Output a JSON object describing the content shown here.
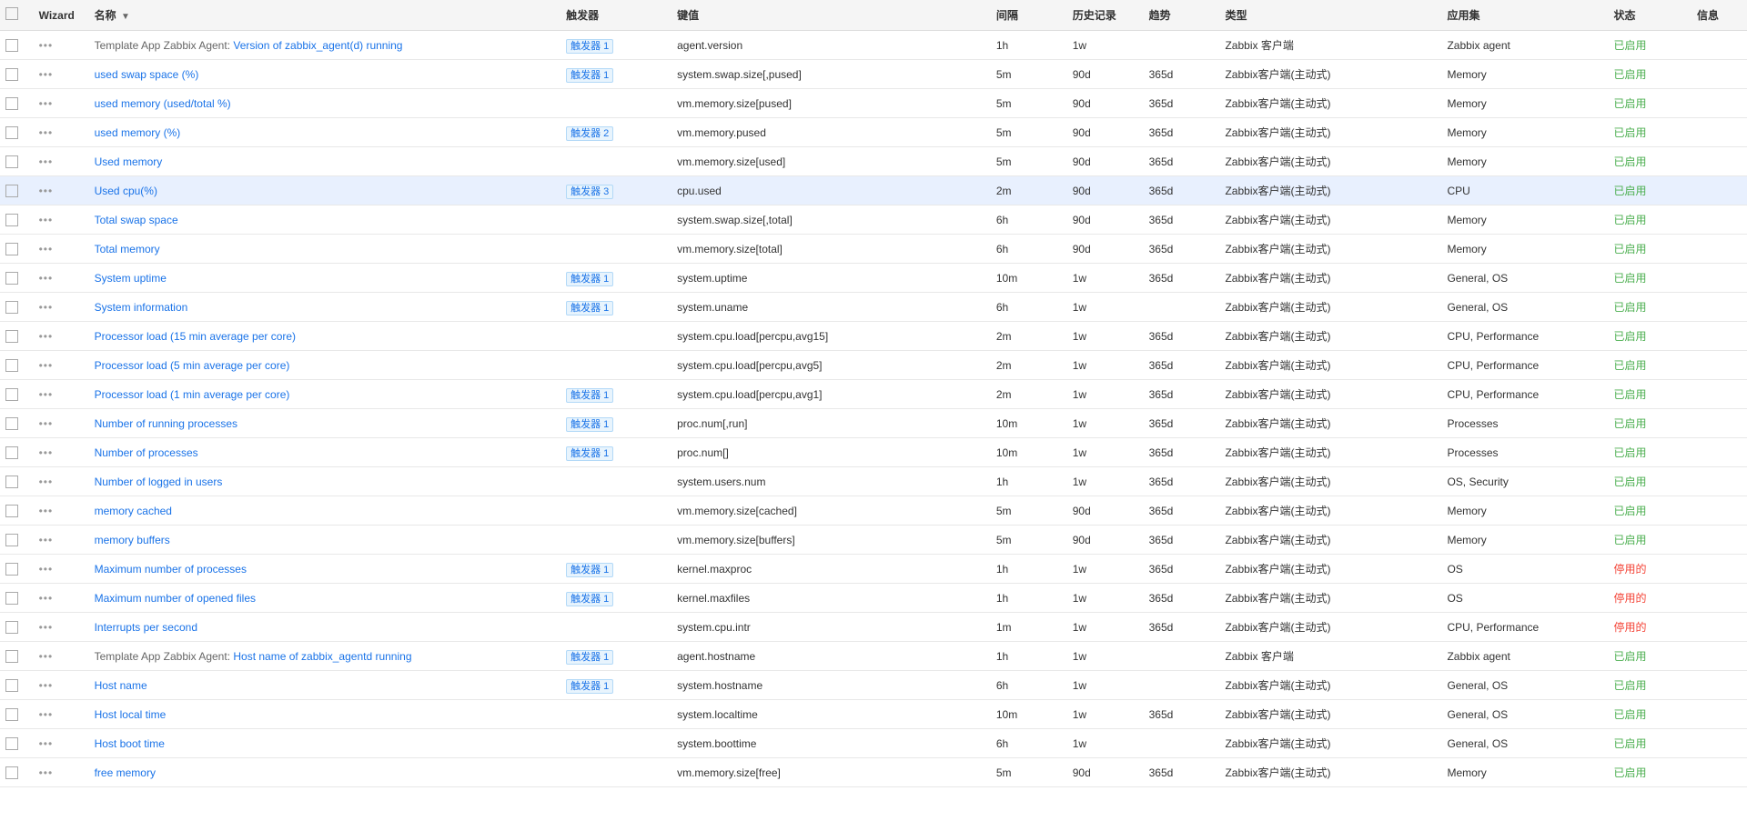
{
  "columns": {
    "checkbox": "",
    "wizard": "Wizard",
    "name": "名称",
    "trigger": "触发器",
    "key": "键值",
    "interval": "间隔",
    "history": "历史记录",
    "trend": "趋势",
    "type": "类型",
    "appgroup": "应用集",
    "status": "状态",
    "info": "信息"
  },
  "rows": [
    {
      "id": 1,
      "name": "Template App Zabbix Agent: Version of zabbix_agent(d) running",
      "namePrefix": "Template App Zabbix Agent: ",
      "nameSuffix": "Version of zabbix_agent(d) running",
      "trigger": "触发器 1",
      "key": "agent.version",
      "interval": "1h",
      "history": "1w",
      "trend": "",
      "type": "Zabbix 客户端",
      "appgroup": "Zabbix agent",
      "status": "已启用",
      "statusClass": "status-enabled",
      "highlighted": false
    },
    {
      "id": 2,
      "name": "used swap space (%)",
      "namePrefix": "",
      "nameSuffix": "used swap space (%)",
      "trigger": "触发器 1",
      "key": "system.swap.size[,pused]",
      "interval": "5m",
      "history": "90d",
      "trend": "365d",
      "type": "Zabbix客户端(主动式)",
      "appgroup": "Memory",
      "status": "已启用",
      "statusClass": "status-enabled",
      "highlighted": false
    },
    {
      "id": 3,
      "name": "used memory (used/total %)",
      "namePrefix": "",
      "nameSuffix": "used memory (used/total %)",
      "trigger": "",
      "key": "vm.memory.size[pused]",
      "interval": "5m",
      "history": "90d",
      "trend": "365d",
      "type": "Zabbix客户端(主动式)",
      "appgroup": "Memory",
      "status": "已启用",
      "statusClass": "status-enabled",
      "highlighted": false
    },
    {
      "id": 4,
      "name": "used memory (%)",
      "namePrefix": "",
      "nameSuffix": "used memory (%)",
      "trigger": "触发器 2",
      "key": "vm.memory.pused",
      "interval": "5m",
      "history": "90d",
      "trend": "365d",
      "type": "Zabbix客户端(主动式)",
      "appgroup": "Memory",
      "status": "已启用",
      "statusClass": "status-enabled",
      "highlighted": false
    },
    {
      "id": 5,
      "name": "Used memory",
      "namePrefix": "",
      "nameSuffix": "Used memory",
      "trigger": "",
      "key": "vm.memory.size[used]",
      "interval": "5m",
      "history": "90d",
      "trend": "365d",
      "type": "Zabbix客户端(主动式)",
      "appgroup": "Memory",
      "status": "已启用",
      "statusClass": "status-enabled",
      "highlighted": false
    },
    {
      "id": 6,
      "name": "Used cpu(%)",
      "namePrefix": "",
      "nameSuffix": "Used cpu(%)",
      "trigger": "触发器 3",
      "key": "cpu.used",
      "interval": "2m",
      "history": "90d",
      "trend": "365d",
      "type": "Zabbix客户端(主动式)",
      "appgroup": "CPU",
      "status": "已启用",
      "statusClass": "status-enabled",
      "highlighted": true
    },
    {
      "id": 7,
      "name": "Total swap space",
      "namePrefix": "",
      "nameSuffix": "Total swap space",
      "trigger": "",
      "key": "system.swap.size[,total]",
      "interval": "6h",
      "history": "90d",
      "trend": "365d",
      "type": "Zabbix客户端(主动式)",
      "appgroup": "Memory",
      "status": "已启用",
      "statusClass": "status-enabled",
      "highlighted": false
    },
    {
      "id": 8,
      "name": "Total memory",
      "namePrefix": "",
      "nameSuffix": "Total memory",
      "trigger": "",
      "key": "vm.memory.size[total]",
      "interval": "6h",
      "history": "90d",
      "trend": "365d",
      "type": "Zabbix客户端(主动式)",
      "appgroup": "Memory",
      "status": "已启用",
      "statusClass": "status-enabled",
      "highlighted": false
    },
    {
      "id": 9,
      "name": "System uptime",
      "namePrefix": "",
      "nameSuffix": "System uptime",
      "trigger": "触发器 1",
      "key": "system.uptime",
      "interval": "10m",
      "history": "1w",
      "trend": "365d",
      "type": "Zabbix客户端(主动式)",
      "appgroup": "General, OS",
      "status": "已启用",
      "statusClass": "status-enabled",
      "highlighted": false
    },
    {
      "id": 10,
      "name": "System information",
      "namePrefix": "",
      "nameSuffix": "System information",
      "trigger": "触发器 1",
      "key": "system.uname",
      "interval": "6h",
      "history": "1w",
      "trend": "",
      "type": "Zabbix客户端(主动式)",
      "appgroup": "General, OS",
      "status": "已启用",
      "statusClass": "status-enabled",
      "highlighted": false
    },
    {
      "id": 11,
      "name": "Processor load (15 min average per core)",
      "namePrefix": "",
      "nameSuffix": "Processor load (15 min average per core)",
      "trigger": "",
      "key": "system.cpu.load[percpu,avg15]",
      "interval": "2m",
      "history": "1w",
      "trend": "365d",
      "type": "Zabbix客户端(主动式)",
      "appgroup": "CPU, Performance",
      "status": "已启用",
      "statusClass": "status-enabled",
      "highlighted": false
    },
    {
      "id": 12,
      "name": "Processor load (5 min average per core)",
      "namePrefix": "",
      "nameSuffix": "Processor load (5 min average per core)",
      "trigger": "",
      "key": "system.cpu.load[percpu,avg5]",
      "interval": "2m",
      "history": "1w",
      "trend": "365d",
      "type": "Zabbix客户端(主动式)",
      "appgroup": "CPU, Performance",
      "status": "已启用",
      "statusClass": "status-enabled",
      "highlighted": false
    },
    {
      "id": 13,
      "name": "Processor load (1 min average per core)",
      "namePrefix": "",
      "nameSuffix": "Processor load (1 min average per core)",
      "trigger": "触发器 1",
      "key": "system.cpu.load[percpu,avg1]",
      "interval": "2m",
      "history": "1w",
      "trend": "365d",
      "type": "Zabbix客户端(主动式)",
      "appgroup": "CPU, Performance",
      "status": "已启用",
      "statusClass": "status-enabled",
      "highlighted": false
    },
    {
      "id": 14,
      "name": "Number of running processes",
      "namePrefix": "",
      "nameSuffix": "Number of running processes",
      "trigger": "触发器 1",
      "key": "proc.num[,run]",
      "interval": "10m",
      "history": "1w",
      "trend": "365d",
      "type": "Zabbix客户端(主动式)",
      "appgroup": "Processes",
      "status": "已启用",
      "statusClass": "status-enabled",
      "highlighted": false
    },
    {
      "id": 15,
      "name": "Number of processes",
      "namePrefix": "",
      "nameSuffix": "Number of processes",
      "trigger": "触发器 1",
      "key": "proc.num[]",
      "interval": "10m",
      "history": "1w",
      "trend": "365d",
      "type": "Zabbix客户端(主动式)",
      "appgroup": "Processes",
      "status": "已启用",
      "statusClass": "status-enabled",
      "highlighted": false
    },
    {
      "id": 16,
      "name": "Number of logged in users",
      "namePrefix": "",
      "nameSuffix": "Number of logged in users",
      "trigger": "",
      "key": "system.users.num",
      "interval": "1h",
      "history": "1w",
      "trend": "365d",
      "type": "Zabbix客户端(主动式)",
      "appgroup": "OS, Security",
      "status": "已启用",
      "statusClass": "status-enabled",
      "highlighted": false
    },
    {
      "id": 17,
      "name": "memory cached",
      "namePrefix": "",
      "nameSuffix": "memory cached",
      "trigger": "",
      "key": "vm.memory.size[cached]",
      "interval": "5m",
      "history": "90d",
      "trend": "365d",
      "type": "Zabbix客户端(主动式)",
      "appgroup": "Memory",
      "status": "已启用",
      "statusClass": "status-enabled",
      "highlighted": false
    },
    {
      "id": 18,
      "name": "memory buffers",
      "namePrefix": "",
      "nameSuffix": "memory buffers",
      "trigger": "",
      "key": "vm.memory.size[buffers]",
      "interval": "5m",
      "history": "90d",
      "trend": "365d",
      "type": "Zabbix客户端(主动式)",
      "appgroup": "Memory",
      "status": "已启用",
      "statusClass": "status-enabled",
      "highlighted": false
    },
    {
      "id": 19,
      "name": "Maximum number of processes",
      "namePrefix": "",
      "nameSuffix": "Maximum number of processes",
      "trigger": "触发器 1",
      "key": "kernel.maxproc",
      "interval": "1h",
      "history": "1w",
      "trend": "365d",
      "type": "Zabbix客户端(主动式)",
      "appgroup": "OS",
      "status": "停用的",
      "statusClass": "status-disabled",
      "highlighted": false
    },
    {
      "id": 20,
      "name": "Maximum number of opened files",
      "namePrefix": "",
      "nameSuffix": "Maximum number of opened files",
      "trigger": "触发器 1",
      "key": "kernel.maxfiles",
      "interval": "1h",
      "history": "1w",
      "trend": "365d",
      "type": "Zabbix客户端(主动式)",
      "appgroup": "OS",
      "status": "停用的",
      "statusClass": "status-disabled",
      "highlighted": false
    },
    {
      "id": 21,
      "name": "Interrupts per second",
      "namePrefix": "",
      "nameSuffix": "Interrupts per second",
      "trigger": "",
      "key": "system.cpu.intr",
      "interval": "1m",
      "history": "1w",
      "trend": "365d",
      "type": "Zabbix客户端(主动式)",
      "appgroup": "CPU, Performance",
      "status": "停用的",
      "statusClass": "status-disabled",
      "highlighted": false
    },
    {
      "id": 22,
      "name": "Template App Zabbix Agent: Host name of zabbix_agentd running",
      "namePrefix": "Template App Zabbix Agent: ",
      "nameSuffix": "Host name of zabbix_agentd running",
      "trigger": "触发器 1",
      "key": "agent.hostname",
      "interval": "1h",
      "history": "1w",
      "trend": "",
      "type": "Zabbix 客户端",
      "appgroup": "Zabbix agent",
      "status": "已启用",
      "statusClass": "status-enabled",
      "highlighted": false
    },
    {
      "id": 23,
      "name": "Host name",
      "namePrefix": "",
      "nameSuffix": "Host name",
      "trigger": "触发器 1",
      "key": "system.hostname",
      "interval": "6h",
      "history": "1w",
      "trend": "",
      "type": "Zabbix客户端(主动式)",
      "appgroup": "General, OS",
      "status": "已启用",
      "statusClass": "status-enabled",
      "highlighted": false
    },
    {
      "id": 24,
      "name": "Host local time",
      "namePrefix": "",
      "nameSuffix": "Host local time",
      "trigger": "",
      "key": "system.localtime",
      "interval": "10m",
      "history": "1w",
      "trend": "365d",
      "type": "Zabbix客户端(主动式)",
      "appgroup": "General, OS",
      "status": "已启用",
      "statusClass": "status-enabled",
      "highlighted": false
    },
    {
      "id": 25,
      "name": "Host boot time",
      "namePrefix": "",
      "nameSuffix": "Host boot time",
      "trigger": "",
      "key": "system.boottime",
      "interval": "6h",
      "history": "1w",
      "trend": "",
      "type": "Zabbix客户端(主动式)",
      "appgroup": "General, OS",
      "status": "已启用",
      "statusClass": "status-enabled",
      "highlighted": false
    },
    {
      "id": 26,
      "name": "free memory",
      "namePrefix": "",
      "nameSuffix": "free memory",
      "trigger": "",
      "key": "vm.memory.size[free]",
      "interval": "5m",
      "history": "90d",
      "trend": "365d",
      "type": "Zabbix客户端(主动式)",
      "appgroup": "Memory",
      "status": "已启用",
      "statusClass": "status-enabled",
      "highlighted": false
    }
  ]
}
